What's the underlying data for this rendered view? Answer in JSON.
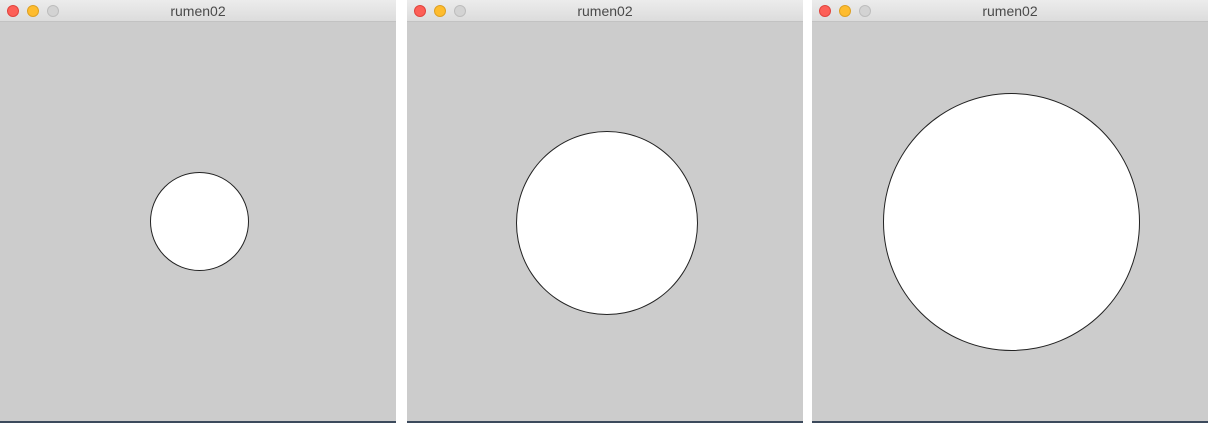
{
  "windows": [
    {
      "title": "rumen02",
      "controls": {
        "close": "close-button",
        "minimize": "minimize-button",
        "zoom": "zoom-button"
      },
      "canvas_background": "#cccccc",
      "circle_fill": "#ffffff"
    },
    {
      "title": "rumen02",
      "controls": {
        "close": "close-button",
        "minimize": "minimize-button",
        "zoom": "zoom-button"
      },
      "canvas_background": "#cccccc",
      "circle_fill": "#ffffff"
    },
    {
      "title": "rumen02",
      "controls": {
        "close": "close-button",
        "minimize": "minimize-button",
        "zoom": "zoom-button"
      },
      "canvas_background": "#cccccc",
      "circle_fill": "#ffffff"
    }
  ]
}
